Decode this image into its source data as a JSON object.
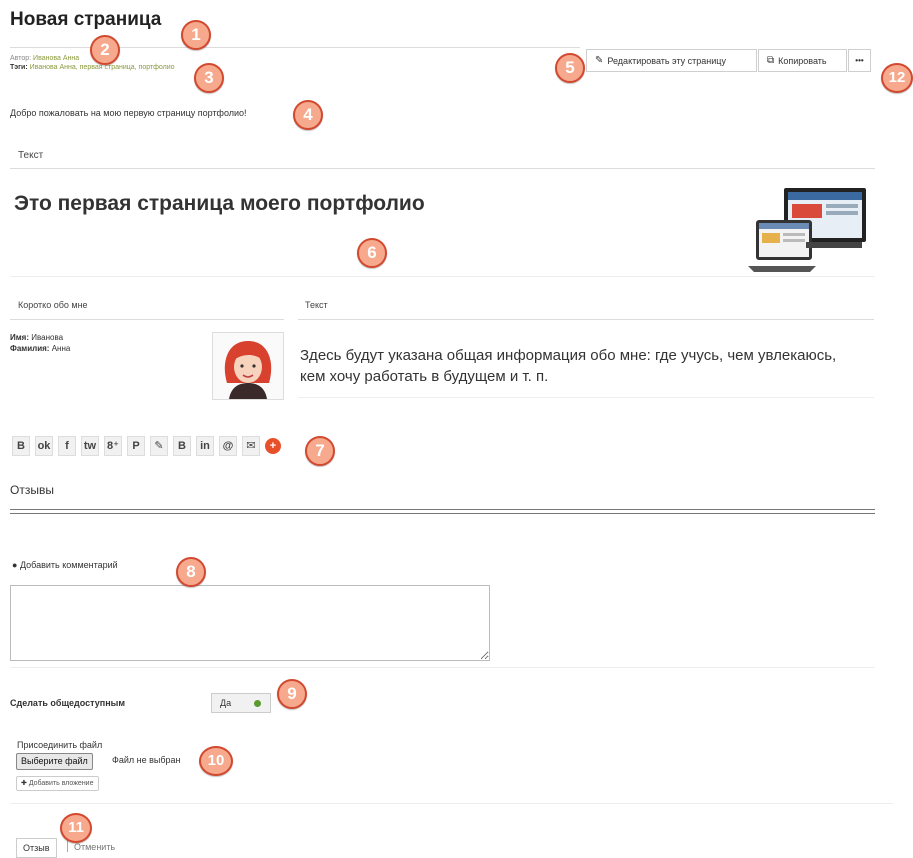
{
  "page": {
    "title": "Новая страница",
    "author_label": "Автор:",
    "author_value": "Иванова Анна",
    "tags_label": "Тэги:",
    "tags_value": "Иванова Анна, первая страница, портфолио",
    "welcome": "Добро пожаловать на мою первую страницу портфолио!"
  },
  "toolbar": {
    "edit_label": "Редактировать эту страницу",
    "copy_label": "Копировать",
    "more_label": "•••"
  },
  "blocks": {
    "text_block_title": "Текст",
    "headline": "Это первая страница моего портфолио",
    "about_title": "Коротко обо мне",
    "about_name_label": "Имя:",
    "about_name_value": "Иванова",
    "about_surname_label": "Фамилия:",
    "about_surname_value": "Анна",
    "text2_title": "Текст",
    "text2_body": "Здесь будут указана общая информация обо мне: где учусь, чем увлекаюсь, кем хочу работать в будущем и т. п."
  },
  "share": {
    "icons": [
      "B",
      "ok",
      "f",
      "tw",
      "8⁺",
      "P",
      "✎",
      "B",
      "in",
      "@",
      "✉",
      "+"
    ]
  },
  "feedback": {
    "title": "Отзывы",
    "add_comment": "Добавить комментарий",
    "public_label": "Сделать общедоступным",
    "public_toggle": "Да",
    "attach_label": "Присоединить файл",
    "choose_file": "Выберите файл",
    "no_file": "Файл не выбран",
    "add_attachment": "Добавить вложение",
    "submit": "Отзыв",
    "cancel": "Отменить"
  },
  "callouts": [
    "1",
    "2",
    "3",
    "4",
    "5",
    "6",
    "7",
    "8",
    "9",
    "10",
    "11",
    "12"
  ],
  "colors": {
    "badge_fill": "#f6a98d",
    "badge_border": "#d2492f",
    "meta_link": "#8a9a3c",
    "toggle_on": "#5a9a2e",
    "share_plus": "#e8502a"
  }
}
